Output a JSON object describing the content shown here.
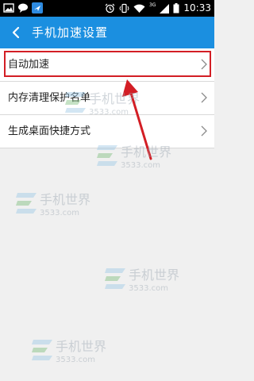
{
  "status_bar": {
    "time": "10:33",
    "network": "3G",
    "icons": [
      "image-icon",
      "chat-icon",
      "notification-icon",
      "alarm-icon",
      "vibrate-icon",
      "wifi-icon",
      "signal-icon",
      "battery-icon"
    ]
  },
  "header": {
    "title": "手机加速设置",
    "back_icon": "back-arrow-icon",
    "background_color": "#1b8fe0"
  },
  "settings": {
    "items": [
      {
        "label": "自动加速"
      },
      {
        "label": "内存清理保护名单"
      },
      {
        "label": "生成桌面快捷方式"
      }
    ]
  },
  "annotation": {
    "highlight_color": "#d31e25"
  },
  "watermark": {
    "brand": "手机世界",
    "domain": "3533.com"
  }
}
